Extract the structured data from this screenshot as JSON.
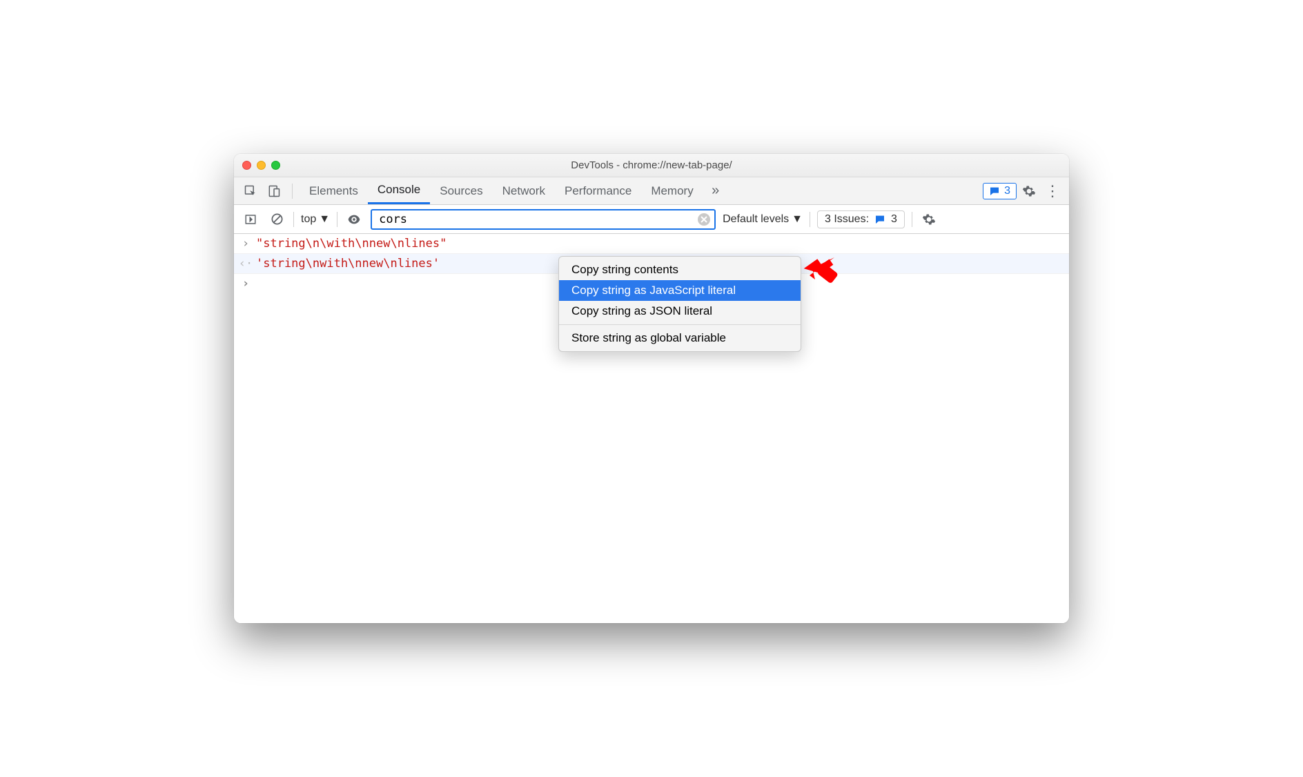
{
  "window": {
    "title": "DevTools - chrome://new-tab-page/"
  },
  "tabs": {
    "items": [
      "Elements",
      "Console",
      "Sources",
      "Network",
      "Performance",
      "Memory"
    ],
    "active": "Console",
    "badge_count": "3"
  },
  "toolbar": {
    "context": "top",
    "filter_value": "cors",
    "levels_label": "Default levels",
    "issues_label": "3 Issues:",
    "issues_count": "3"
  },
  "console": {
    "input_line": "\"string\\n\\with\\nnew\\nlines\"",
    "output_line": "'string\\nwith\\nnew\\nlines'"
  },
  "contextmenu": {
    "items": [
      "Copy string contents",
      "Copy string as JavaScript literal",
      "Copy string as JSON literal"
    ],
    "selected_index": 1,
    "secondary": "Store string as global variable"
  }
}
